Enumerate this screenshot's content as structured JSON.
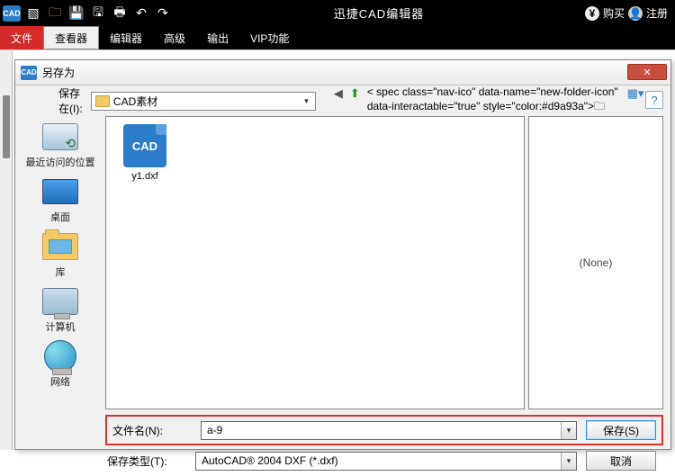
{
  "app": {
    "title": "迅捷CAD编辑器",
    "logo": "CAD",
    "buy": "购买",
    "register": "注册"
  },
  "menu": {
    "file": "文件",
    "viewer": "查看器",
    "editor": "编辑器",
    "advanced": "高级",
    "output": "输出",
    "vip": "VIP功能"
  },
  "dialog": {
    "title": "另存为",
    "save_in_label": "保存在(I):",
    "folder": "CAD素材",
    "preview_none": "(None)",
    "filename_label": "文件名(N):",
    "filename_value": "a-9",
    "filetype_label": "保存类型(T):",
    "filetype_value": "AutoCAD® 2004 DXF (*.dxf)",
    "save_btn": "保存(S)",
    "cancel_btn": "取消"
  },
  "places": {
    "recent": "最近访问的位置",
    "desktop": "桌面",
    "library": "库",
    "computer": "计算机",
    "network": "网络"
  },
  "file": {
    "name": "y1.dxf",
    "icon_label": "CAD"
  }
}
